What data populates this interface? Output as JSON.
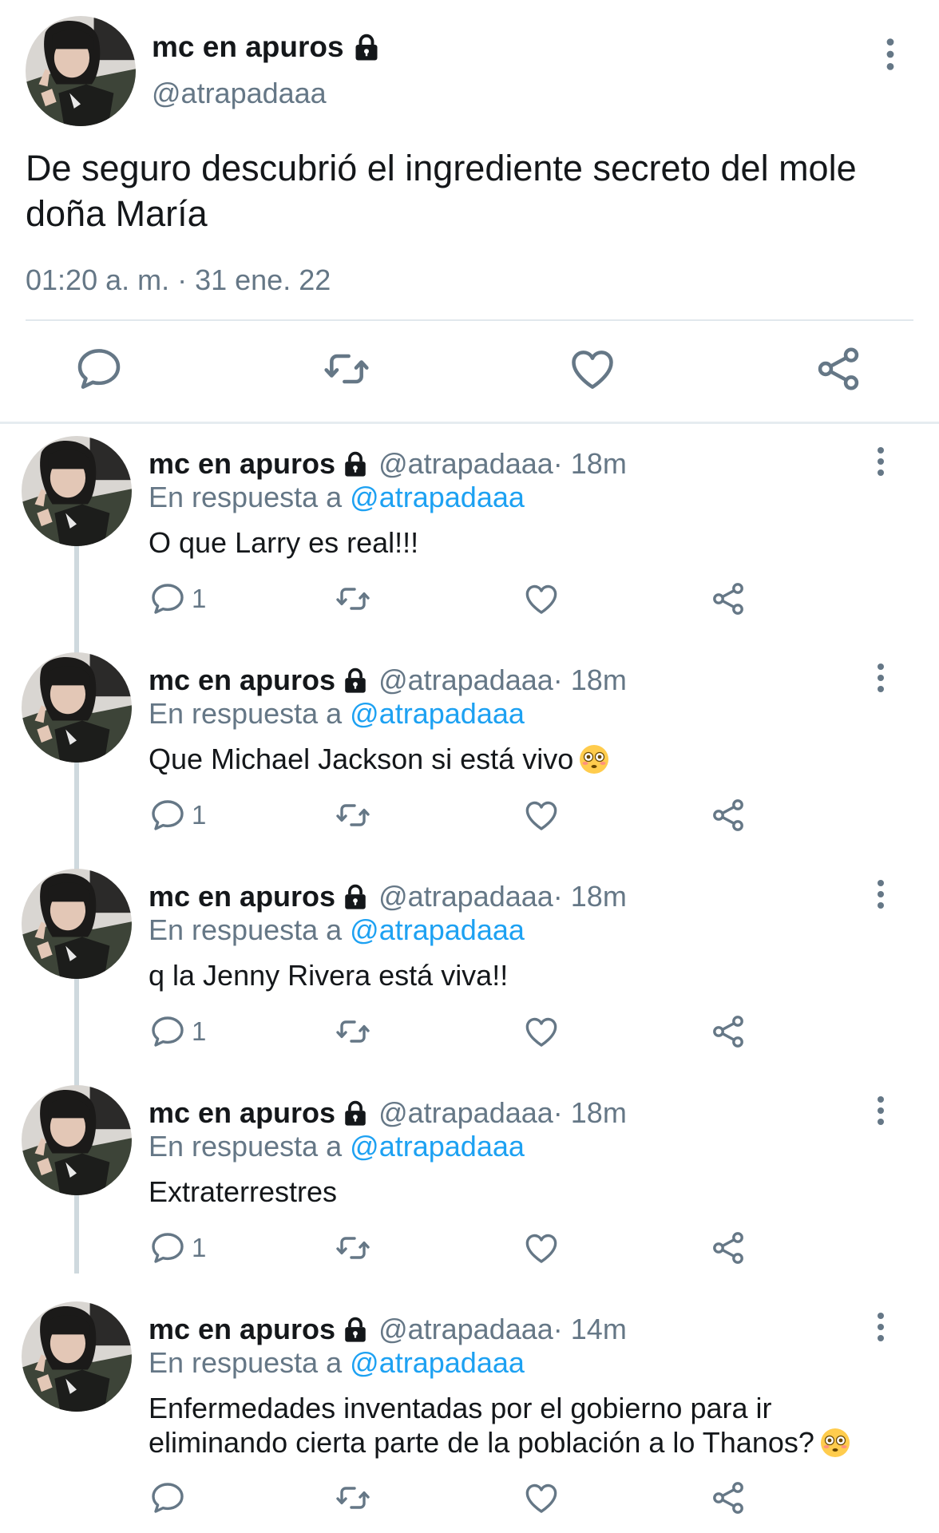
{
  "main": {
    "name": "mc en apuros",
    "handle": "@atrapadaaa",
    "text": "De seguro descubrió el ingrediente secreto del mole doña María",
    "timestamp": "01:20 a. m. · 31 ene. 22",
    "icons": [
      "reply-icon",
      "retweet-icon",
      "like-icon",
      "share-icon"
    ]
  },
  "replies": [
    {
      "name": "mc en apuros",
      "handle": "@atrapadaaa",
      "time": " · 18m",
      "replying_prefix": "En respuesta a ",
      "replying_to": "@atrapadaaa",
      "text": "O que Larry es real!!!",
      "reply_count": "1"
    },
    {
      "name": "mc en apuros",
      "handle": "@atrapadaaa",
      "time": " · 18m",
      "replying_prefix": "En respuesta a ",
      "replying_to": "@atrapadaaa",
      "text": "Que Michael Jackson si está vivo",
      "reply_count": "1"
    },
    {
      "name": "mc en apuros",
      "handle": "@atrapadaaa",
      "time": " · 18m",
      "replying_prefix": "En respuesta a ",
      "replying_to": "@atrapadaaa",
      "text": "q la Jenny Rivera está viva!!",
      "reply_count": "1"
    },
    {
      "name": "mc en apuros",
      "handle": "@atrapadaaa",
      "time": " · 18m",
      "replying_prefix": "En respuesta a ",
      "replying_to": "@atrapadaaa",
      "text": "Extraterrestres",
      "reply_count": "1"
    },
    {
      "name": "mc en apuros",
      "handle": "@atrapadaaa",
      "time": " · 14m",
      "replying_prefix": "En respuesta a ",
      "replying_to": "@atrapadaaa",
      "text": "Enfermedades inventadas por el gobierno para ir eliminando cierta parte de la población a lo Thanos?",
      "reply_count": ""
    }
  ],
  "colors": {
    "text": "#14171a",
    "secondary": "#657786",
    "link": "#1da1f2",
    "divider": "#e1e8ed"
  }
}
